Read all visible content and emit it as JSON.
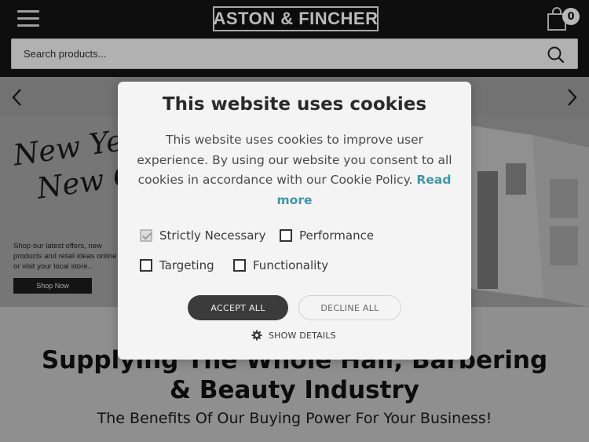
{
  "header": {
    "logo_text": "ASTON & FINCHER",
    "cart_count": "0"
  },
  "search": {
    "placeholder": "Search products..."
  },
  "banner": {
    "script_line1": "New Year",
    "script_line2": "New Of",
    "copy": "Shop our latest offers, new products and retail ideas online or visit your local store...",
    "cta": "Shop Now"
  },
  "page": {
    "headline": "Supplying The Whole Hair, Barbering & Beauty Industry",
    "subheadline": "The Benefits Of Our Buying Power For Your Business!"
  },
  "cookie": {
    "title": "This website uses cookies",
    "body": "This website uses cookies to improve user experience. By using our website you consent to all cookies in accordance with our Cookie Policy.",
    "read_more": "Read more",
    "options": {
      "strictly_necessary": "Strictly Necessary",
      "performance": "Performance",
      "targeting": "Targeting",
      "functionality": "Functionality"
    },
    "accept_all": "ACCEPT ALL",
    "decline_all": "DECLINE ALL",
    "show_details": "SHOW DETAILS"
  }
}
